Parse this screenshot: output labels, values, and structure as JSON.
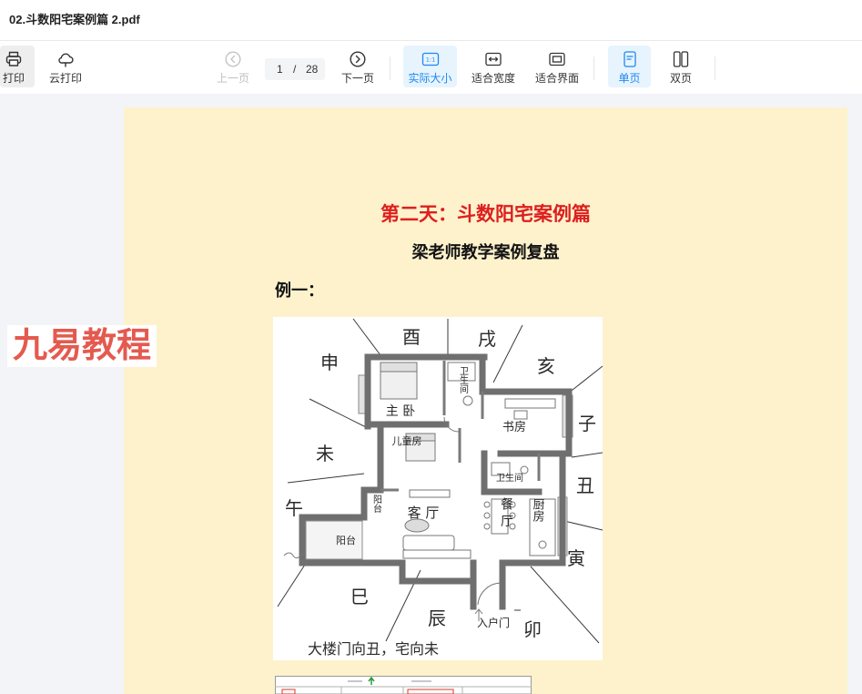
{
  "window": {
    "title": "02.斗数阳宅案例篇 2.pdf"
  },
  "toolbar": {
    "print": {
      "label": "打印",
      "icon": "printer-icon",
      "hovered": true
    },
    "cloud_print": {
      "label": "云打印",
      "icon": "cloud-icon"
    },
    "prev_page": {
      "label": "上一页",
      "icon": "circle-chevron-left-icon",
      "disabled": true
    },
    "page_nav": {
      "current": "1",
      "separator": "/",
      "total": "28"
    },
    "next_page": {
      "label": "下一页",
      "icon": "circle-chevron-right-icon"
    },
    "actual_size": {
      "label": "实际大小",
      "icon": "actual-size-icon",
      "icon_text": "1:1",
      "active": true
    },
    "fit_width": {
      "label": "适合宽度",
      "icon": "fit-width-icon"
    },
    "fit_page": {
      "label": "适合界面",
      "icon": "fit-page-icon"
    },
    "single_page": {
      "label": "单页",
      "icon": "single-page-icon",
      "active": true
    },
    "double_page": {
      "label": "双页",
      "icon": "double-page-icon"
    }
  },
  "watermark": {
    "text": "九易教程"
  },
  "document": {
    "title": "第二天：斗数阳宅案例篇",
    "subtitle": "梁老师教学案例复盘",
    "example_label": "例一：",
    "floorplan": {
      "directions": [
        "酉",
        "戌",
        "亥",
        "申",
        "子",
        "未",
        "丑",
        "午",
        "寅",
        "巳",
        "辰",
        "卯"
      ],
      "rooms": [
        "主 卧",
        "卫生间",
        "书房",
        "儿童房",
        "卫生间",
        "客 厅",
        "餐 厅",
        "厨房",
        "阳台",
        "阳台",
        "入户门"
      ],
      "caption": "大楼门向丑，宅向未"
    }
  },
  "colors": {
    "accent": "#1e87f0",
    "active_bg": "#e7f4fe",
    "disabled": "#bfbfbf",
    "viewer_bg": "#f3f4f8",
    "page_bg": "#fdf2cc",
    "doc_title": "#dd1f1f",
    "watermark": "#e45a4f"
  }
}
